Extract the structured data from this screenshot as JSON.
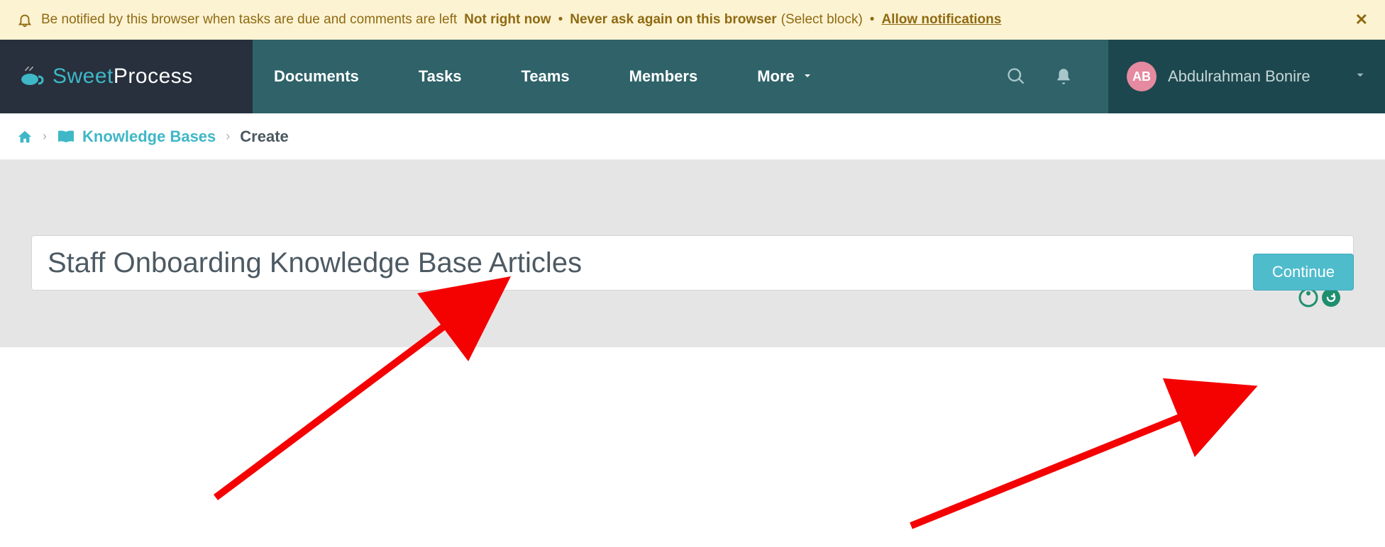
{
  "notification": {
    "message": "Be notified by this browser when tasks are due and comments are left",
    "not_now": "Not right now",
    "never": "Never ask again on this browser",
    "select_block": "(Select block)",
    "allow": "Allow notifications"
  },
  "brand": {
    "sweet": "Sweet",
    "process": "Process"
  },
  "nav": {
    "documents": "Documents",
    "tasks": "Tasks",
    "teams": "Teams",
    "members": "Members",
    "more": "More"
  },
  "user": {
    "initials": "AB",
    "name": "Abdulrahman Bonire"
  },
  "breadcrumb": {
    "kb": "Knowledge Bases",
    "create": "Create"
  },
  "form": {
    "title_value": "Staff Onboarding Knowledge Base Articles",
    "continue": "Continue"
  }
}
